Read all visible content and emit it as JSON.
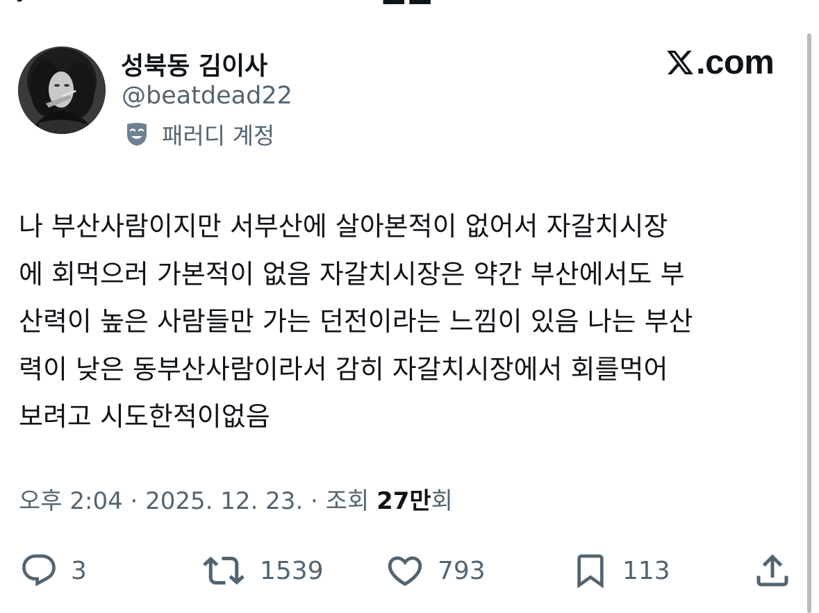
{
  "profile": {
    "display_name": "성북동 김이사",
    "handle": "@beatdead22",
    "parody_label": "패러디 계정"
  },
  "brand": {
    "domain": "com",
    "dot": "."
  },
  "tweet": {
    "text": "나 부산사람이지만 서부산에 살아본적이 없어서 자갈치시장\n에 회먹으러 가본적이 없음 자갈치시장은 약간 부산에서도 부\n산력이 높은 사람들만 가는 던전이라는 느낌이 있음 나는 부산\n력이 낮은 동부산사람이라서 감히 자갈치시장에서 회를먹어\n보려고 시도한적이없음"
  },
  "meta": {
    "time": "오후 2:04",
    "separator1": " · ",
    "date": "2025. 12. 23.",
    "separator2": " · ",
    "views_label": "조회 ",
    "views_number": "27만",
    "views_suffix": "회"
  },
  "actions": {
    "replies": "3",
    "reposts": "1539",
    "likes": "793",
    "bookmarks": "113"
  },
  "icons": {
    "reply": "speech-bubble-icon",
    "repost": "repost-arrows-icon",
    "like": "heart-icon",
    "bookmark": "bookmark-icon",
    "share": "share-upload-icon",
    "parody": "theater-mask-icon",
    "logo": "x-logo-icon"
  },
  "colors": {
    "text_primary": "#0f1419",
    "text_secondary": "#536471",
    "background": "#ffffff"
  }
}
